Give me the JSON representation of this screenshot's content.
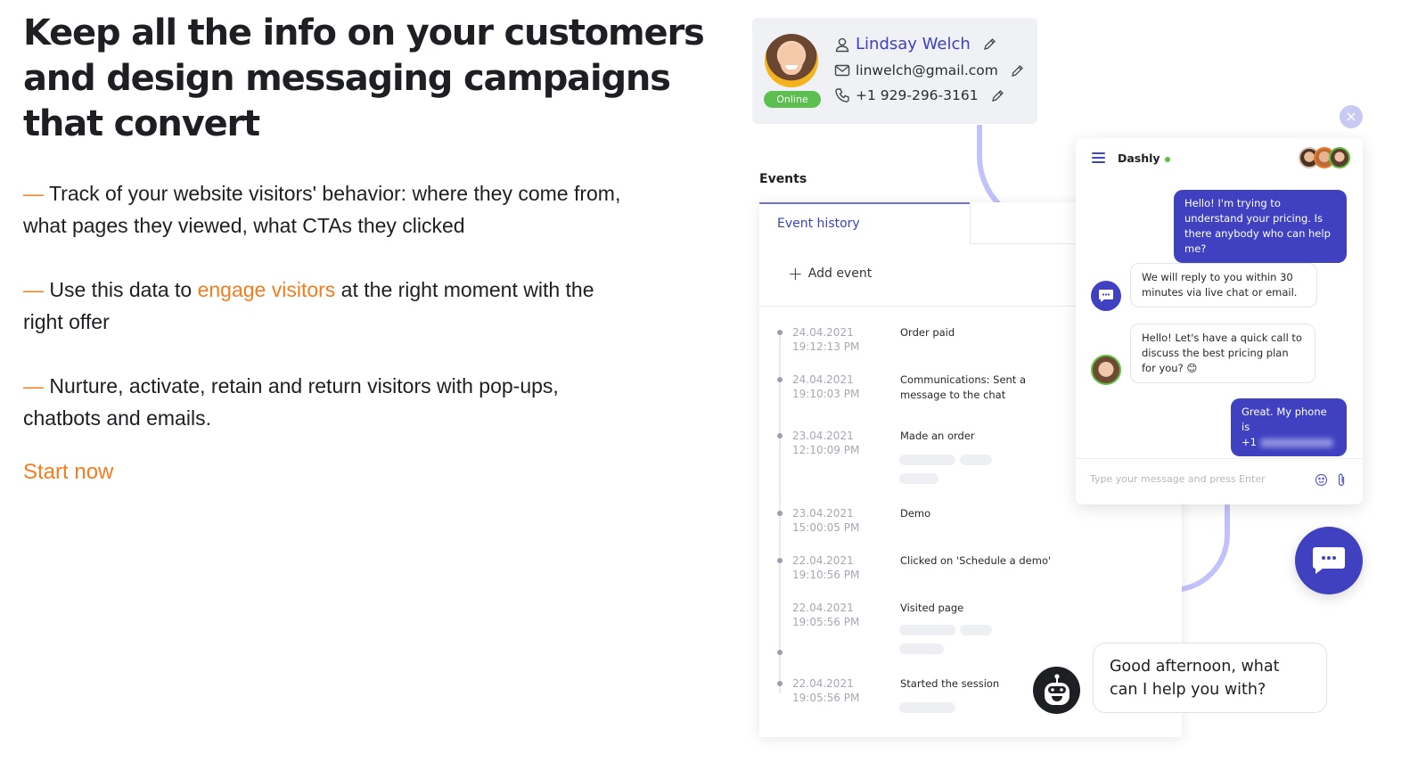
{
  "hero": {
    "headline": "Keep all the info on your customers and design messaging campaigns that convert",
    "bullets": [
      {
        "dash": "—",
        "text": " Track of your website visitors' behavior: where they come from, what pages they viewed, what CTAs they clicked"
      },
      {
        "dash": "—",
        "pre": " Use this data to ",
        "highlight": "engage visitors",
        "post": " at the right moment with the right offer"
      },
      {
        "dash": "—",
        "text": " Nurture, activate, retain and return visitors with pop-ups, chatbots and emails."
      }
    ],
    "cta_label": "Start now",
    "accent_color": "#f57c1f"
  },
  "contact": {
    "status": "Online",
    "name": "Lindsay Welch",
    "email": "linwelch@gmail.com",
    "phone": "+1 929-296-3161",
    "icons": [
      "user-icon",
      "mail-icon",
      "phone-icon",
      "pencil-icon"
    ]
  },
  "events": {
    "title": "Events",
    "tab_label": "Event history",
    "add_label": "Add event",
    "items": [
      {
        "date": "24.04.2021",
        "time": "19:12:13 PM",
        "text": "Order paid"
      },
      {
        "date": "24.04.2021",
        "time": "19:10:03 PM",
        "text": "Communications: Sent a message to the chat"
      },
      {
        "date": "23.04.2021",
        "time": "12:10:09 PM",
        "text": "Made an order"
      },
      {
        "date": "23.04.2021",
        "time": "15:00:05 PM",
        "text": "Demo"
      },
      {
        "date": "22.04.2021",
        "time": "19:10:56 PM",
        "text": "Clicked on 'Schedule a demo'"
      },
      {
        "date": "22.04.2021",
        "time": "19:05:56 PM",
        "text": "Visited page"
      },
      {
        "date": "22.04.2021",
        "time": "19:05:56 PM",
        "text": "Started the session"
      }
    ]
  },
  "chat": {
    "brand": "Dashly",
    "close_icon": "×",
    "messages": [
      {
        "from": "visitor",
        "text": "Hello! I'm trying to understand your pricing. Is there anybody who can help me?"
      },
      {
        "from": "bot",
        "text": "We will reply to you within 30 minutes via live chat or email."
      },
      {
        "from": "agent",
        "text": "Hello! Let's have a quick call to discuss the best pricing plan for you? 😊"
      },
      {
        "from": "visitor",
        "text": "Great. My phone is",
        "text_line2": "+1"
      }
    ],
    "input_placeholder": "Type your message and press Enter",
    "brand_color": "#3f41c0"
  },
  "bot_greeting": {
    "text": "Good afternoon, what can I help you with?"
  }
}
